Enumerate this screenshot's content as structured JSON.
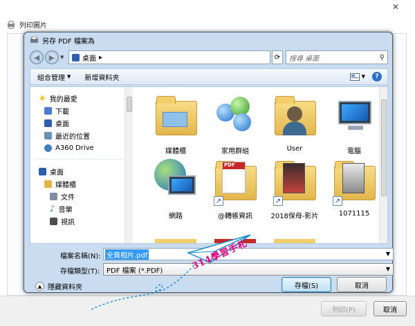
{
  "outer_window": {
    "title": "列印圖片",
    "close_glyph": "✕",
    "print_button": "列印(P)",
    "cancel_button": "取消"
  },
  "dialog": {
    "title": "另存 PDF 檔案為",
    "address": {
      "location": "桌面",
      "arrow": "▸"
    },
    "search_placeholder": "搜尋 桌面",
    "toolbar": {
      "organize": "組合管理",
      "new_folder": "新增資料夾"
    },
    "nav_tree": [
      {
        "label": "我的最愛",
        "icon": "star-icon",
        "color": "#f0c020"
      },
      {
        "label": "下載",
        "icon": "download-folder-icon",
        "color": "#4a7bd0"
      },
      {
        "label": "桌面",
        "icon": "desktop-icon",
        "color": "#2d5fb0"
      },
      {
        "label": "最近的位置",
        "icon": "recent-places-icon",
        "color": "#6d8fb3"
      },
      {
        "label": "A360 Drive",
        "icon": "cloud-drive-icon",
        "color": "#3f7fbf"
      },
      {
        "label": "桌面",
        "icon": "desktop-icon",
        "color": "#2d5fb0"
      },
      {
        "label": "媒體櫃",
        "icon": "library-icon",
        "color": "#e4b440"
      },
      {
        "label": "文件",
        "icon": "documents-icon",
        "color": "#7c8ea4"
      },
      {
        "label": "音樂",
        "icon": "music-icon",
        "color": "#3d7cc9"
      },
      {
        "label": "視訊",
        "icon": "video-icon",
        "color": "#4c4c4c"
      }
    ],
    "files": [
      {
        "label": "媒體櫃",
        "kind": "library-folder"
      },
      {
        "label": "家用群組",
        "kind": "homegroup"
      },
      {
        "label": "User",
        "kind": "user-folder"
      },
      {
        "label": "電腦",
        "kind": "computer"
      },
      {
        "label": "網路",
        "kind": "network"
      },
      {
        "label": "@轉帳資訊",
        "kind": "pdf-shortcut"
      },
      {
        "label": "2018保母-影片",
        "kind": "folder-shortcut"
      },
      {
        "label": "1071115",
        "kind": "folder-shortcut"
      }
    ],
    "file_name_label": "檔案名稱(N):",
    "file_name_value": "全頁相片.pdf",
    "file_type_label": "存檔類型(T):",
    "file_type_value": "PDF 檔案 (*.PDF)",
    "hide_folders": "隱藏資料夾",
    "save_button": "存檔(S)",
    "cancel_button": "取消"
  },
  "watermark": "314學習手札",
  "colors": {
    "dialog_frame": "#c9dcf0",
    "selection": "#3399ff",
    "watermark": "#e3007e",
    "plane": "#1f8fd0"
  }
}
